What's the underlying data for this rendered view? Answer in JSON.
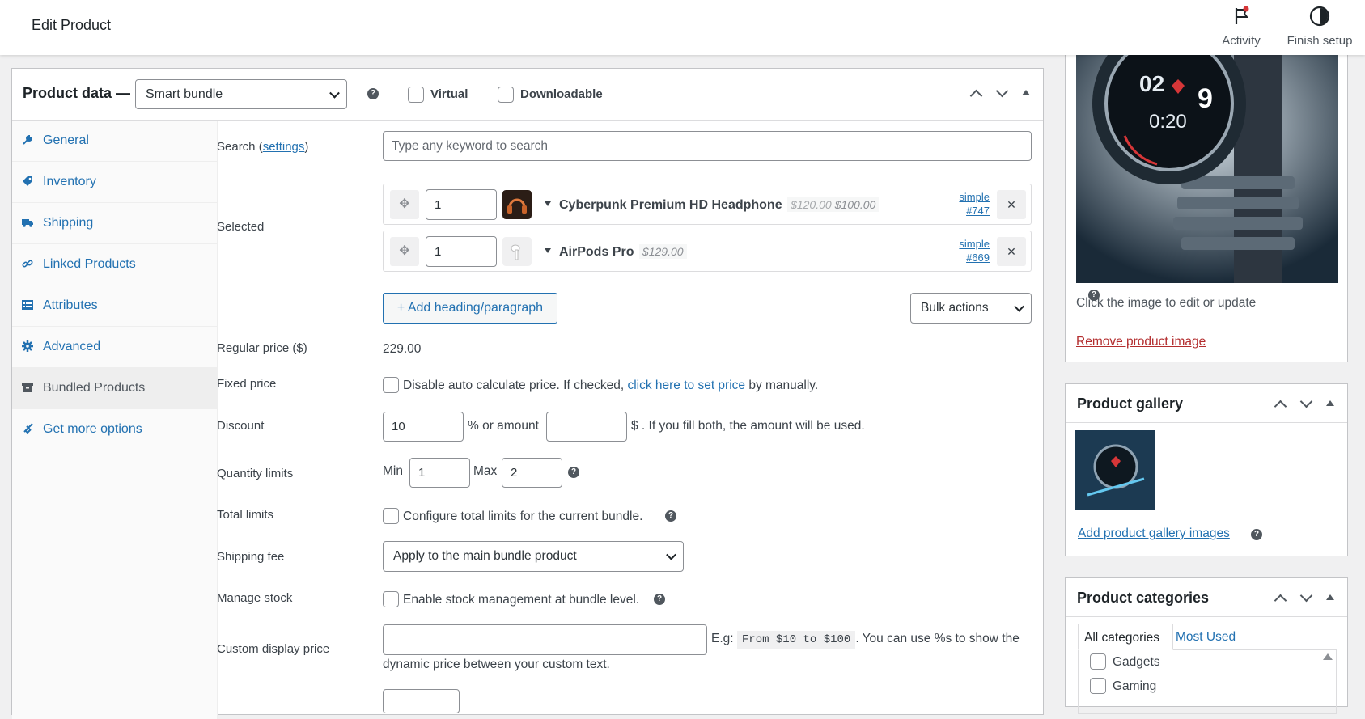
{
  "topbar": {
    "title": "Edit Product",
    "activity_label": "Activity",
    "finish_setup_label": "Finish setup"
  },
  "product_data": {
    "title": "Product data —",
    "type_select_value": "Smart bundle",
    "virtual_label": "Virtual",
    "downloadable_label": "Downloadable"
  },
  "tabs": [
    {
      "label": "General",
      "icon": "wrench-icon"
    },
    {
      "label": "Inventory",
      "icon": "tag-icon"
    },
    {
      "label": "Shipping",
      "icon": "truck-icon"
    },
    {
      "label": "Linked Products",
      "icon": "link-icon"
    },
    {
      "label": "Attributes",
      "icon": "list-icon"
    },
    {
      "label": "Advanced",
      "icon": "gear-icon"
    },
    {
      "label": "Bundled Products",
      "icon": "archive-icon"
    },
    {
      "label": "Get more options",
      "icon": "plugin-icon"
    }
  ],
  "bundle": {
    "search_label": "Search (",
    "search_settings_link": "settings",
    "search_label_end": ")",
    "search_placeholder": "Type any keyword to search",
    "selected_label": "Selected",
    "items": [
      {
        "qty": "1",
        "name": "Cyberpunk Premium HD Headphone",
        "old_price": "$120.00",
        "price": "$100.00",
        "type": "simple",
        "id": "#747"
      },
      {
        "qty": "1",
        "name": "AirPods Pro",
        "old_price": "",
        "price": "$129.00",
        "type": "simple",
        "id": "#669"
      }
    ],
    "add_heading_label": "+ Add heading/paragraph",
    "bulk_actions_label": "Bulk actions",
    "regular_price_label": "Regular price ($)",
    "regular_price_value": "229.00",
    "fixed_price_label": "Fixed price",
    "fixed_price_text_1": "Disable auto calculate price. If checked,",
    "fixed_price_link": "click here to set price",
    "fixed_price_text_2": "by manually.",
    "discount_label": "Discount",
    "discount_value": "10",
    "discount_text_1": "% or amount",
    "discount_amount_value": "",
    "discount_text_2": "$ . If you fill both, the amount will be used.",
    "quantity_limits_label": "Quantity limits",
    "min_label": "Min",
    "min_value": "1",
    "max_label": "Max",
    "max_value": "2",
    "total_limits_label": "Total limits",
    "total_limits_text": "Configure total limits for the current bundle.",
    "shipping_fee_label": "Shipping fee",
    "shipping_fee_value": "Apply to the main bundle product",
    "manage_stock_label": "Manage stock",
    "manage_stock_text": "Enable stock management at bundle level.",
    "custom_display_label": "Custom display price",
    "custom_display_value": "",
    "custom_display_eg": "E.g:",
    "custom_display_code": "From $10 to $100",
    "custom_display_text_1": ". You can use %s to show the",
    "custom_display_text_2": "dynamic price between your custom text."
  },
  "sidebar": {
    "image_hint": "Click the image to edit or update",
    "remove_image_link": "Remove product image",
    "gallery_title": "Product gallery",
    "add_gallery_link": "Add product gallery images",
    "categories_title": "Product categories",
    "cat_tab_all": "All categories",
    "cat_tab_most_used": "Most Used",
    "categories": [
      "Gadgets",
      "Gaming"
    ]
  },
  "colors": {
    "accent": "#2271b1",
    "danger": "#b32d2e"
  }
}
